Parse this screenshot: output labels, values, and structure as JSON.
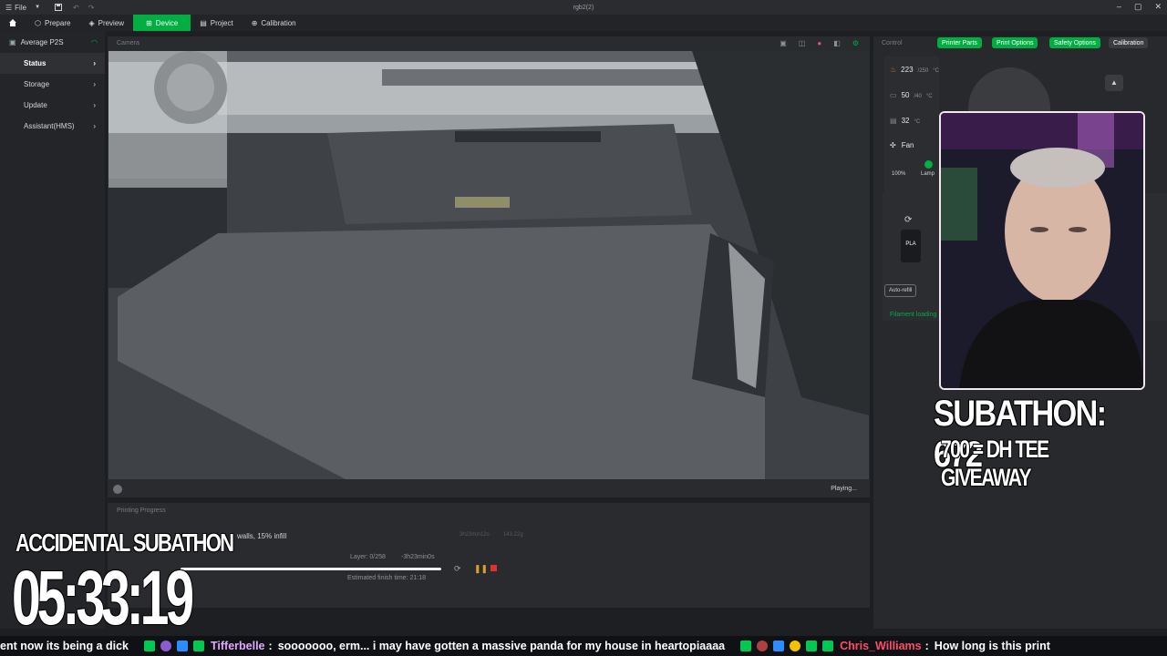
{
  "titlebar": {
    "file_label": "File",
    "window_title": "rgb2(2)"
  },
  "tabs": [
    {
      "label": "Prepare"
    },
    {
      "label": "Preview"
    },
    {
      "label": "Device"
    },
    {
      "label": "Project"
    },
    {
      "label": "Calibration"
    }
  ],
  "sidebar": {
    "printer_name": "Average P2S",
    "items": [
      {
        "label": "Status"
      },
      {
        "label": "Storage"
      },
      {
        "label": "Update"
      },
      {
        "label": "Assistant(HMS)"
      }
    ]
  },
  "camera": {
    "header": "Camera",
    "status": "Playing..."
  },
  "progress": {
    "header": "Printing Progress",
    "job_desc": "walls, 15% infill",
    "time_small": "3h23min12s",
    "weight_small": "143.22g",
    "layer": "Layer: 0/258",
    "remaining": "-3h23min0s",
    "finish": "Estimated finish time: 21:18",
    "progress_pct": 0
  },
  "control": {
    "header": "Control",
    "buttons": [
      "Printer Parts",
      "Print Options",
      "Safety Options",
      "Calibration"
    ],
    "nozzle_temp": "223",
    "nozzle_target": "/250",
    "bed_temp": "50",
    "bed_target": "/40",
    "chamber_temp": "32",
    "unit": "°C",
    "fan_label": "Fan",
    "fan_pct": "100%",
    "lamp_label": "Lamp",
    "ams_slot": "PLA",
    "auto_refill": "Auto-refill",
    "filament_loading": "Filament loading"
  },
  "overlay": {
    "subathon_title": "ACCIDENTAL SUBATHON",
    "timer": "05:33:19",
    "subathon_count": "SUBATHON: 672",
    "giveaway": "700 = DH TEE GIVEAWAY"
  },
  "ticker": {
    "msg1": "ent now its being a dick",
    "user2": "Tifferbelle",
    "msg2": "sooooooo, erm... i may have gotten a massive panda for my house in heartopiaaaa",
    "user3": "Chris_Williams",
    "msg3": "How long is this print"
  }
}
